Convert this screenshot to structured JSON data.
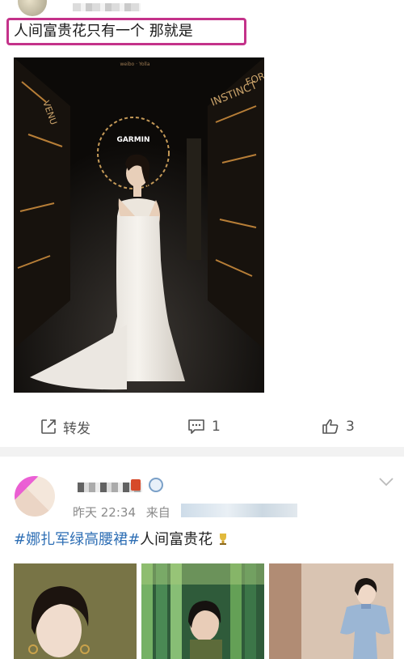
{
  "post1": {
    "text": "人间富贵花只有一个  那就是",
    "photo": {
      "brand_sign": "GARMIN",
      "header_text": "weibo · Yolla",
      "wall_texts": [
        "INSTINCT",
        "FORE",
        "VENU"
      ]
    },
    "actions": {
      "repost_label": "转发",
      "comment_count": "1",
      "like_count": "3"
    }
  },
  "post2": {
    "time": "昨天 22:34",
    "source_prefix": "来自",
    "hashtag": "#娜扎军绿高腰裙#",
    "text_after": "人间富贵花"
  },
  "colors": {
    "highlight": "#c4328a",
    "link": "#2f6fb5",
    "muted": "#8a8a8a"
  }
}
